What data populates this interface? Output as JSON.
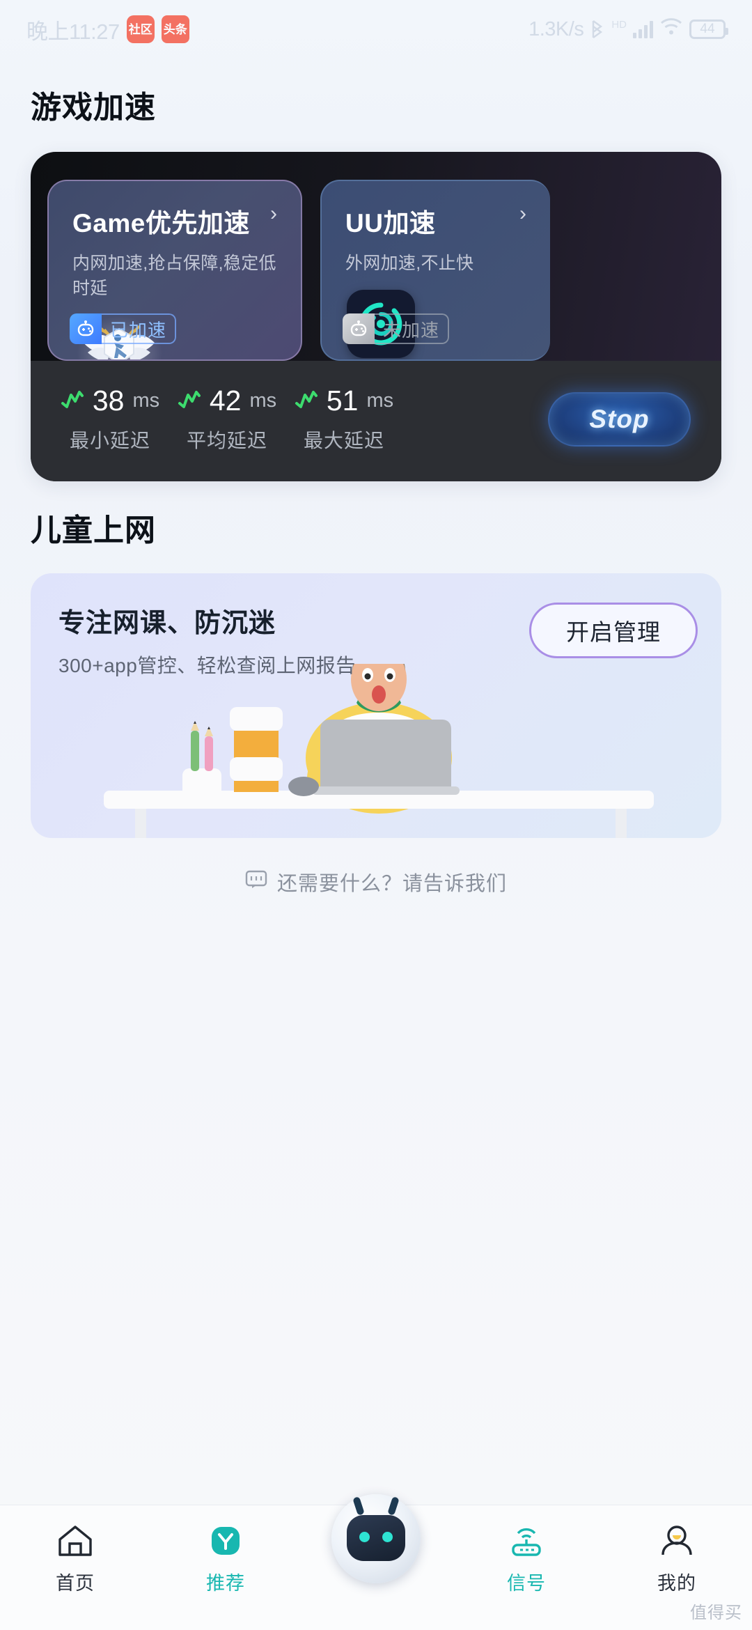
{
  "statusbar": {
    "time": "晚上11:27",
    "app_badges": [
      "社区",
      "头条"
    ],
    "net_speed": "1.3K/s",
    "bluetooth_icon": "bluetooth-icon",
    "hd_label": "HD",
    "signal_icon": "signal-bars-icon",
    "wifi_icon": "wifi-icon",
    "battery_level": "44"
  },
  "sections": {
    "game_title": "游戏加速",
    "kids_title": "儿童上网"
  },
  "game_accel": {
    "cards": [
      {
        "title": "Game优先加速",
        "subtitle": "内网加速,抢占保障,稳定低时延",
        "chevron": "›",
        "logo_icon": "game-winged-emblem-icon",
        "badge_label": "已加速",
        "badge_state": "on",
        "badge_icon": "robot-face-icon"
      },
      {
        "title": "UU加速",
        "subtitle": "外网加速,不止快",
        "chevron": "›",
        "logo_icon": "uu-swirl-icon",
        "badge_label": "未加速",
        "badge_state": "off",
        "badge_icon": "robot-face-icon"
      }
    ],
    "latency": [
      {
        "value": "38",
        "unit": "ms",
        "label": "最小延迟",
        "icon": "pulse-up-icon"
      },
      {
        "value": "42",
        "unit": "ms",
        "label": "平均延迟",
        "icon": "pulse-up-icon"
      },
      {
        "value": "51",
        "unit": "ms",
        "label": "最大延迟",
        "icon": "pulse-up-icon"
      }
    ],
    "stop_button": "Stop"
  },
  "kids": {
    "title": "专注网课、防沉迷",
    "subtitle": "300+app管控、轻松查阅上网报告",
    "button": "开启管理",
    "illustration": "kid-at-laptop-illustration"
  },
  "feedback": {
    "icon": "chat-bubble-icon",
    "text": "还需要什么？请告诉我们"
  },
  "navbar": {
    "items": [
      {
        "label": "首页",
        "icon": "home-icon",
        "active": false
      },
      {
        "label": "推荐",
        "icon": "recommend-y-icon",
        "active": true
      },
      {
        "label": "",
        "icon": "robot-mascot-icon",
        "active": false
      },
      {
        "label": "信号",
        "icon": "router-signal-icon",
        "active": true
      },
      {
        "label": "我的",
        "icon": "person-icon",
        "active": false
      }
    ]
  },
  "watermark": "值得买",
  "colors": {
    "accent_teal": "#18b7b0",
    "accent_blue": "#3e7bff",
    "latency_green": "#3ddc6e",
    "kids_purple": "#a98ee6"
  }
}
